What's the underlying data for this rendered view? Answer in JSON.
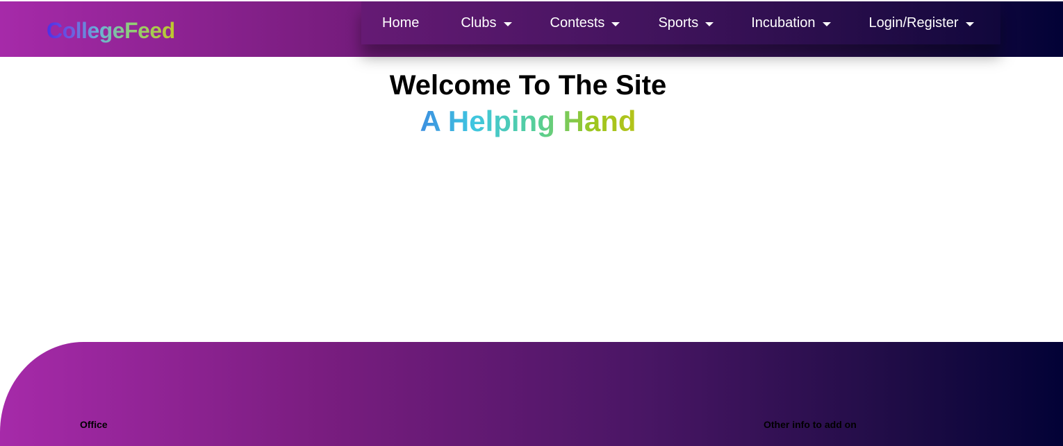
{
  "header": {
    "brand": "CollegeFeed",
    "colors": {
      "gradient_start": "#a62aa9",
      "gradient_end": "#020236"
    }
  },
  "nav": {
    "items": [
      {
        "label": "Home",
        "has_dropdown": false
      },
      {
        "label": "Clubs",
        "has_dropdown": true,
        "icon": "caret-down-icon"
      },
      {
        "label": "Contests",
        "has_dropdown": true,
        "icon": "caret-down-icon"
      },
      {
        "label": "Sports",
        "has_dropdown": true,
        "icon": "caret-down-icon"
      },
      {
        "label": "Incubation",
        "has_dropdown": true,
        "icon": "caret-down-icon"
      },
      {
        "label": "Login/Register",
        "has_dropdown": true,
        "icon": "caret-down-icon"
      }
    ]
  },
  "hero": {
    "title": "Welcome To The Site",
    "subtitle": "A Helping Hand"
  },
  "footer": {
    "office_label": "Office",
    "other_label": "Other info to add on"
  }
}
